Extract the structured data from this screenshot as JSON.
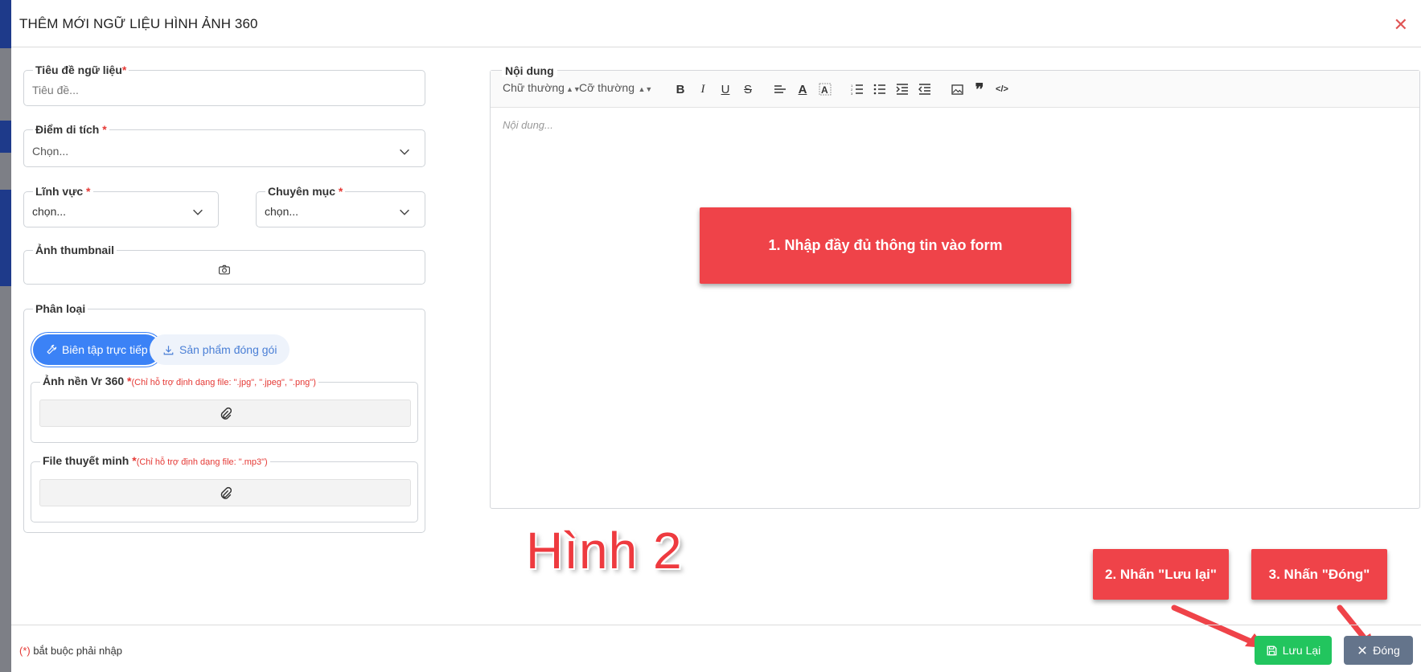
{
  "modal": {
    "title": "THÊM MỚI NGỮ LIỆU HÌNH ẢNH 360",
    "close_icon": "close-icon"
  },
  "form": {
    "title_field": {
      "label": "Tiêu đề ngữ liệu",
      "required": "*",
      "placeholder": "Tiêu đề..."
    },
    "site_field": {
      "label": "Điểm di tích ",
      "required": "*",
      "value": "Chọn..."
    },
    "domain_field": {
      "label": "Lĩnh vực ",
      "required": "*",
      "value": "chọn..."
    },
    "category_field": {
      "label": "Chuyên mục ",
      "required": "*",
      "value": "chọn..."
    },
    "thumbnail_field": {
      "label": "Ảnh thumbnail",
      "icon": "camera-icon"
    },
    "classification": {
      "label": "Phân loại",
      "tabs": [
        {
          "label": "Biên tập trực tiếp",
          "icon": "wrench-icon",
          "active": true
        },
        {
          "label": "Sản phẩm đóng gói",
          "icon": "download-icon",
          "active": false
        }
      ],
      "vr_background": {
        "label": "Ảnh nền Vr 360 ",
        "required": "*",
        "note": "(Chỉ hỗ trợ định dạng file: \".jpg\", \".jpeg\", \".png\")",
        "icon": "paperclip-icon"
      },
      "narration_file": {
        "label": "File thuyết minh ",
        "required": "*",
        "note": "(Chỉ hỗ trợ định dạng file: \".mp3\")",
        "icon": "paperclip-icon"
      }
    }
  },
  "editor": {
    "label": "Nội dung",
    "placeholder": "Nội dung...",
    "font_style": "Chữ thường",
    "font_size": "Cỡ thường",
    "tools": [
      "bold-icon",
      "italic-icon",
      "underline-icon",
      "strikethrough-icon",
      "align-icon",
      "font-color-icon",
      "background-color-icon",
      "ordered-list-icon",
      "bullet-list-icon",
      "indent-icon",
      "outdent-icon",
      "image-icon",
      "blockquote-icon",
      "code-icon"
    ]
  },
  "annotations": {
    "step1": "1. Nhập đầy đủ thông tin vào form",
    "step2": "2. Nhấn \"Lưu lại\"",
    "step3": "3. Nhấn \"Đóng\"",
    "figure_label": "Hình 2",
    "accent_color": "#ef4349"
  },
  "footer": {
    "required_mark": "(*)",
    "required_note": " bắt buộc phải nhập",
    "save_label": "Lưu Lại",
    "close_label": "Đóng",
    "save_color": "#22c55e",
    "close_color": "#64748b"
  }
}
